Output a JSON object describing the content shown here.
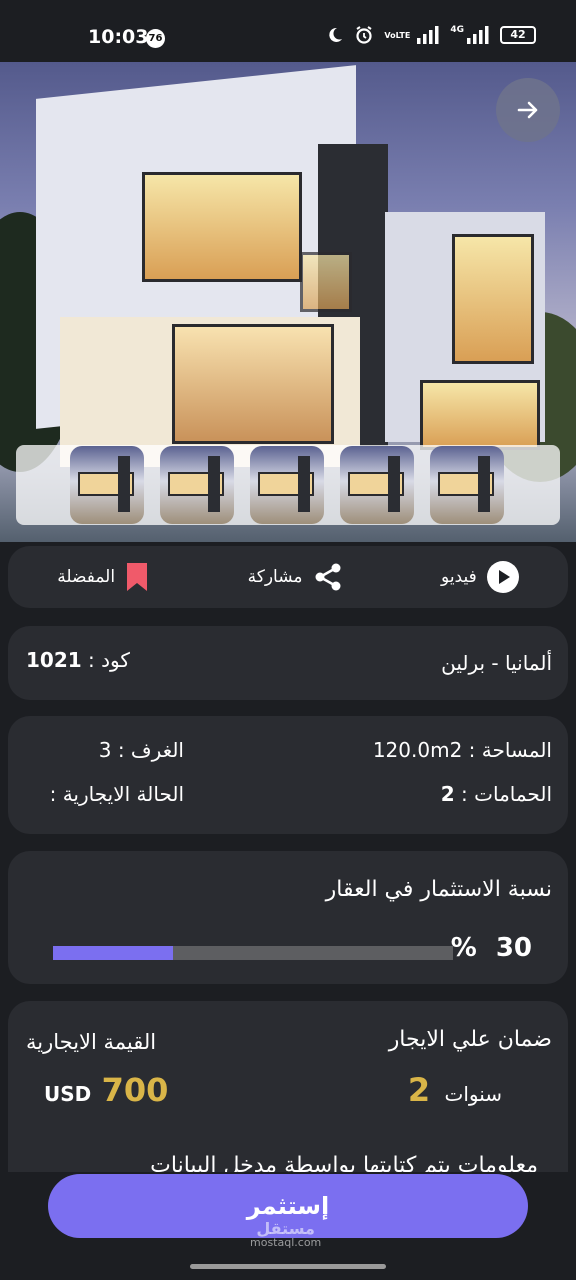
{
  "status_bar": {
    "time": "10:03",
    "notification_count": "76",
    "network_label": "VoLTE",
    "network_type": "4G",
    "battery": "42"
  },
  "gallery": {
    "thumbnail_count": 5
  },
  "actions": {
    "video_label": "فيديو",
    "share_label": "مشاركة",
    "favorite_label": "المفضلة"
  },
  "location": {
    "city": "ألمانيا - برلين",
    "code_label": "كود :",
    "code_value": "1021"
  },
  "specs": {
    "area_label": "المساحة :",
    "area_value": "120.0m2",
    "rooms_label": "الغرف :",
    "rooms_value": "3",
    "bathrooms_label": "الحمامات :",
    "bathrooms_value": "2",
    "rental_status_label": "الحالة الايجارية :"
  },
  "investment": {
    "title": "نسبة الاستثمار في العقار",
    "percent_value": "30",
    "percent_sign": "%",
    "progress_fraction": 0.3
  },
  "rent": {
    "guarantee_label": "ضمان علي الايجار",
    "guarantee_value": "2",
    "guarantee_unit": "سنوات",
    "value_label": "القيمة الايجارية",
    "value_amount": "700",
    "currency": "USD",
    "note": "معلومات يتم كتابتها بواسطة مدخل البيانات"
  },
  "cta": {
    "invest_label": "إستثمر"
  },
  "watermark": {
    "text": "مستقل",
    "domain": "mostaql.com"
  },
  "colors": {
    "accent": "#7b6ff0",
    "gold": "#d9b548",
    "bookmark": "#f05a6a",
    "card": "#2a2c31",
    "background": "#1c1e22"
  }
}
